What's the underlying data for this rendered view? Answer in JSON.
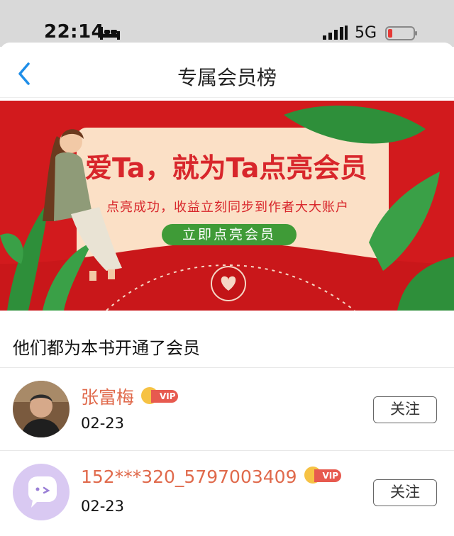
{
  "status_bar": {
    "time": "22:14",
    "network": "5G",
    "icons": [
      "bed-icon",
      "signal-icon",
      "battery-low-icon"
    ]
  },
  "nav": {
    "title": "专属会员榜",
    "back_icon": "chevron-left-icon"
  },
  "banner": {
    "headline": "爱Ta，就为Ta点亮会员",
    "subtitle": "点亮成功，收益立刻同步到作者大大账户",
    "cta_label": "立即点亮会员",
    "colors": {
      "background": "#d21a1d",
      "card": "#fbe0c6",
      "headline": "#d8262b",
      "cta": "#3f9b37",
      "leaf": "#2e8f3a"
    }
  },
  "section": {
    "heading": "他们都为本书开通了会员"
  },
  "members": [
    {
      "name": "张富梅",
      "badge": "VIP",
      "date": "02-23",
      "follow_label": "关注",
      "avatar": "photo-avatar"
    },
    {
      "name": "152***320_5797003409",
      "badge": "VIP",
      "date": "02-23",
      "follow_label": "关注",
      "avatar": "default-chat-avatar"
    }
  ],
  "colors": {
    "accent_back": "#1e8ee8",
    "member_name": "#e06a4c",
    "vip_pill": "#e75a4f",
    "vip_crown": "#f6c244"
  }
}
